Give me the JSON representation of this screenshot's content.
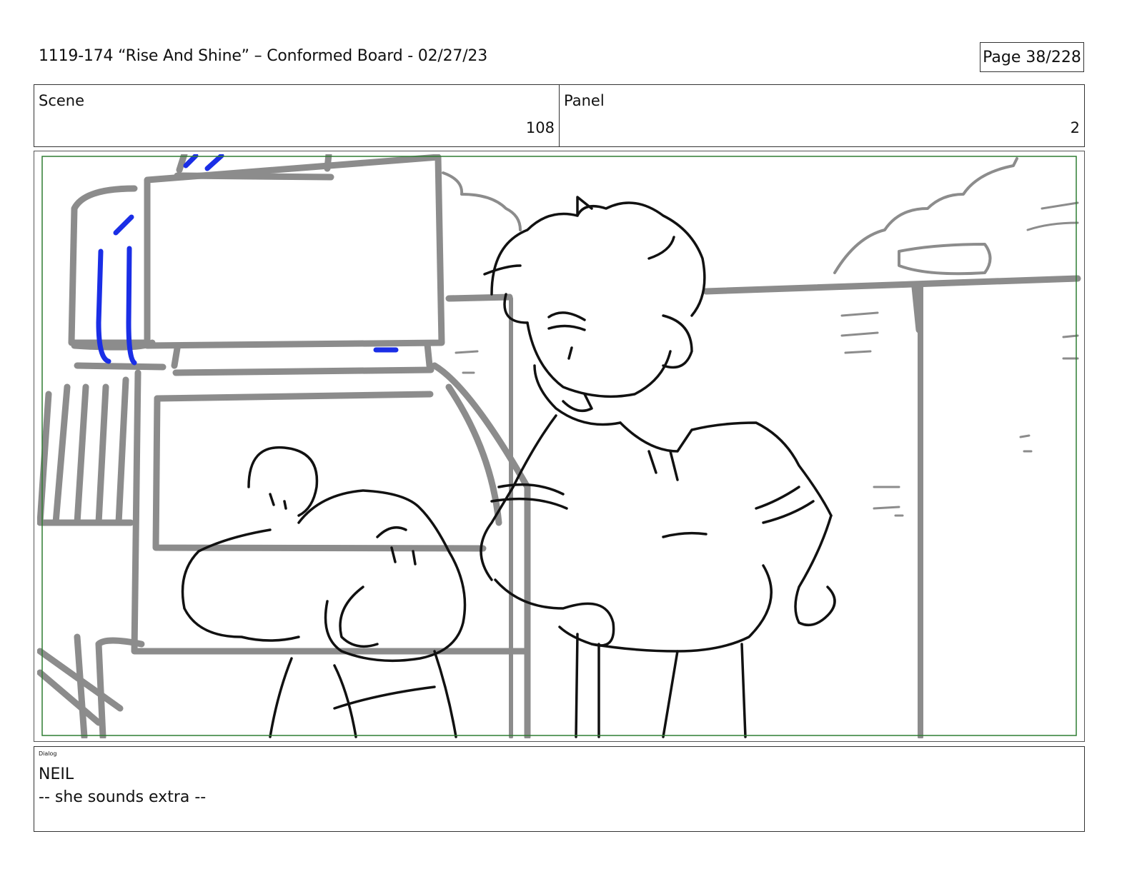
{
  "header": {
    "title": "1119-174 “Rise And Shine” – Conformed Board - 02/27/23",
    "page_label": "Page",
    "page_value": "38/228"
  },
  "info": {
    "scene_label": "Scene",
    "scene_value": "108",
    "panel_label": "Panel",
    "panel_value": "2"
  },
  "frame": {
    "safe_area_color": "#2e7d32",
    "bg_line_color": "#8c8c8c",
    "char_line_color": "#111111",
    "note_color": "#1a2ee6"
  },
  "dialog": {
    "label": "Dialog",
    "speaker": "NEIL",
    "text": "-- she sounds extra --"
  }
}
